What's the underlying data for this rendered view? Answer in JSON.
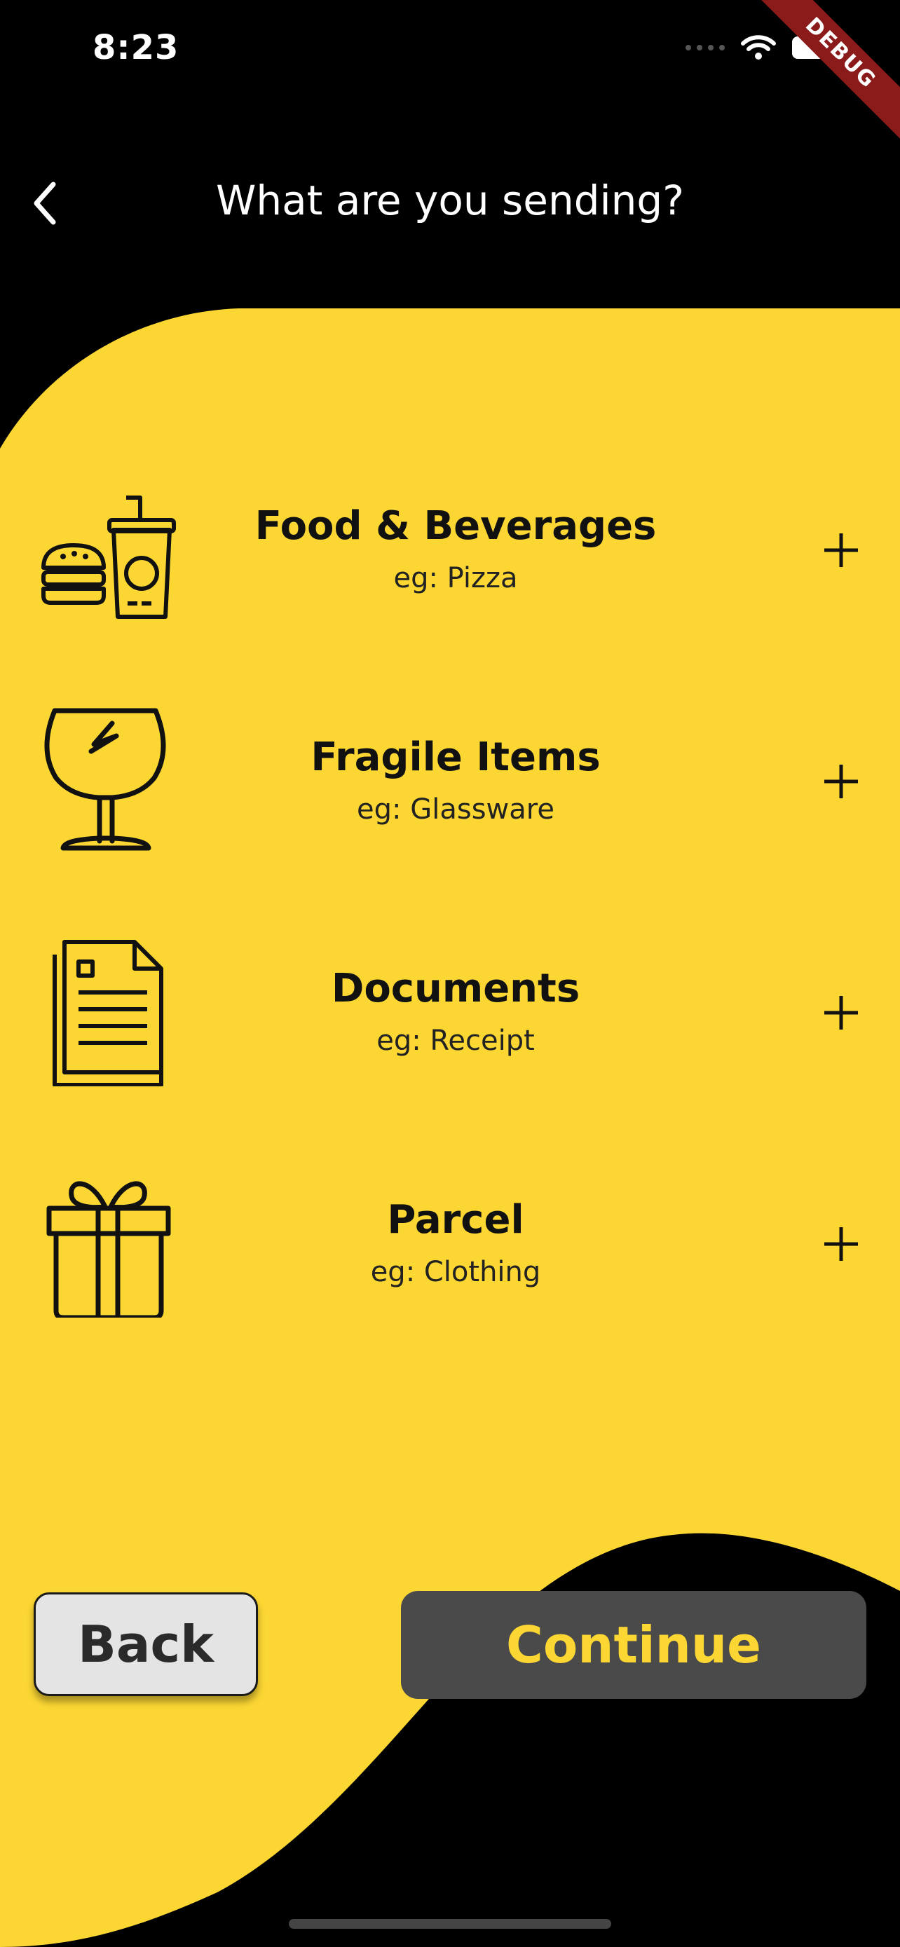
{
  "status_bar": {
    "time": "8:23",
    "debug_label": "DEBUG"
  },
  "header": {
    "title": "What are you sending?",
    "back_icon": "chevron-left-icon"
  },
  "categories": [
    {
      "title": "Food & Beverages",
      "example": "eg: Pizza",
      "icon": "food-beverage-icon",
      "action_icon": "plus-icon"
    },
    {
      "title": "Fragile Items",
      "example": "eg: Glassware",
      "icon": "fragile-glass-icon",
      "action_icon": "plus-icon"
    },
    {
      "title": "Documents",
      "example": "eg: Receipt",
      "icon": "documents-icon",
      "action_icon": "plus-icon"
    },
    {
      "title": "Parcel",
      "example": "eg: Clothing",
      "icon": "gift-parcel-icon",
      "action_icon": "plus-icon"
    }
  ],
  "buttons": {
    "back_label": "Back",
    "continue_label": "Continue"
  },
  "colors": {
    "background": "#000000",
    "accent_yellow": "#fcd733",
    "continue_bg": "#4a4a4a",
    "back_bg": "#e4e4e4",
    "debug_banner": "#8b1b1b"
  }
}
